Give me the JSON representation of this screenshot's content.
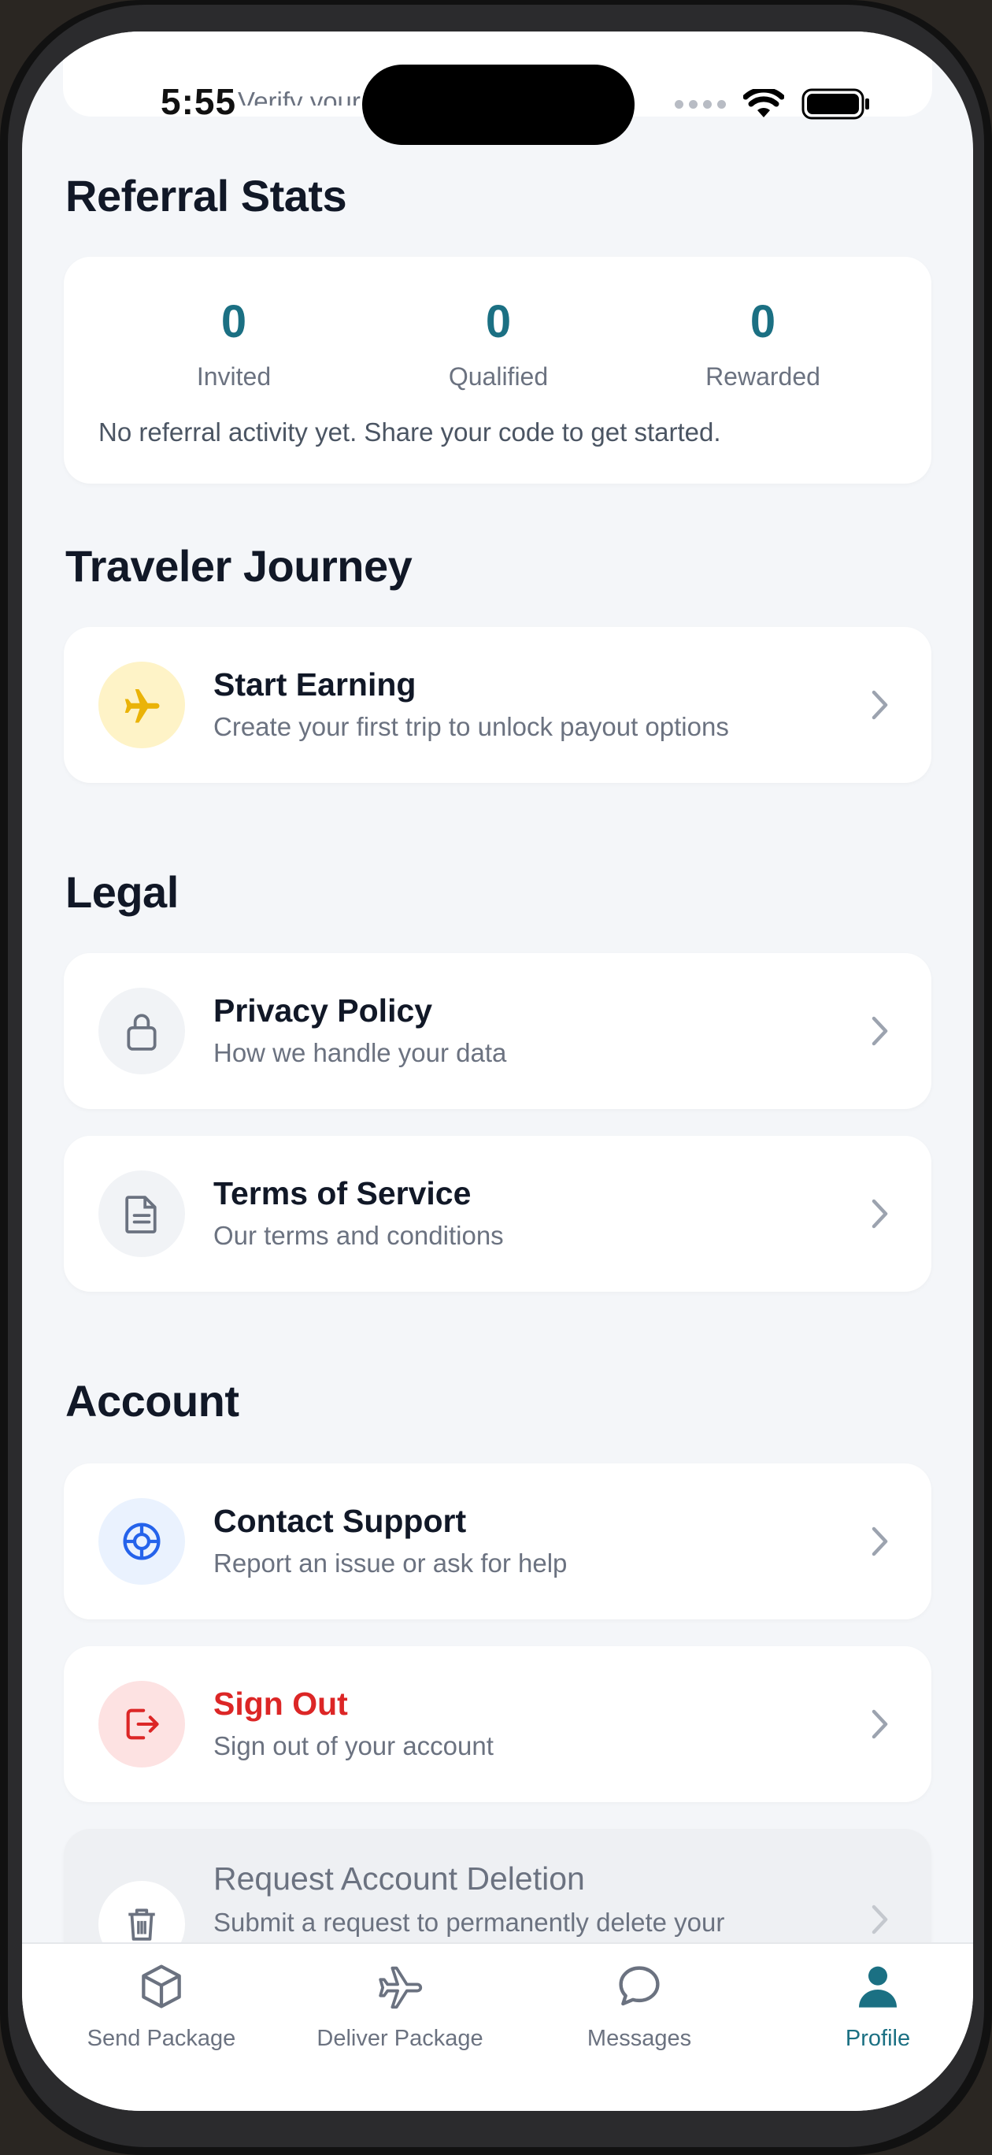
{
  "status_bar": {
    "time": "5:55"
  },
  "top_card": {
    "subtitle": "Verify your identity for security"
  },
  "referral": {
    "title": "Referral Stats",
    "stats": [
      {
        "value": "0",
        "label": "Invited"
      },
      {
        "value": "0",
        "label": "Qualified"
      },
      {
        "value": "0",
        "label": "Rewarded"
      }
    ],
    "note": "No referral activity yet. Share your code to get started."
  },
  "journey": {
    "title": "Traveler Journey",
    "item": {
      "title": "Start Earning",
      "subtitle": "Create your first trip to unlock payout options",
      "icon": "airplane-icon"
    }
  },
  "legal": {
    "title": "Legal",
    "items": [
      {
        "title": "Privacy Policy",
        "subtitle": "How we handle your data",
        "icon": "lock-icon"
      },
      {
        "title": "Terms of Service",
        "subtitle": "Our terms and conditions",
        "icon": "document-icon"
      }
    ]
  },
  "account": {
    "title": "Account",
    "items": [
      {
        "title": "Contact Support",
        "subtitle": "Report an issue or ask for help",
        "icon": "lifebuoy-icon"
      },
      {
        "title": "Sign Out",
        "subtitle": "Sign out of your account",
        "icon": "sign-out-icon"
      },
      {
        "title": "Request Account Deletion",
        "subtitle": "Submit a request to permanently delete your",
        "icon": "trash-icon"
      }
    ]
  },
  "tabs": [
    {
      "label": "Send Package",
      "icon": "package-icon"
    },
    {
      "label": "Deliver Package",
      "icon": "airplane-icon"
    },
    {
      "label": "Messages",
      "icon": "chat-icon"
    },
    {
      "label": "Profile",
      "icon": "user-icon",
      "active": true
    }
  ],
  "colors": {
    "accent": "#1b7083",
    "danger": "#dc2626",
    "warning_bg": "#fef3c7",
    "warning": "#eab308"
  }
}
